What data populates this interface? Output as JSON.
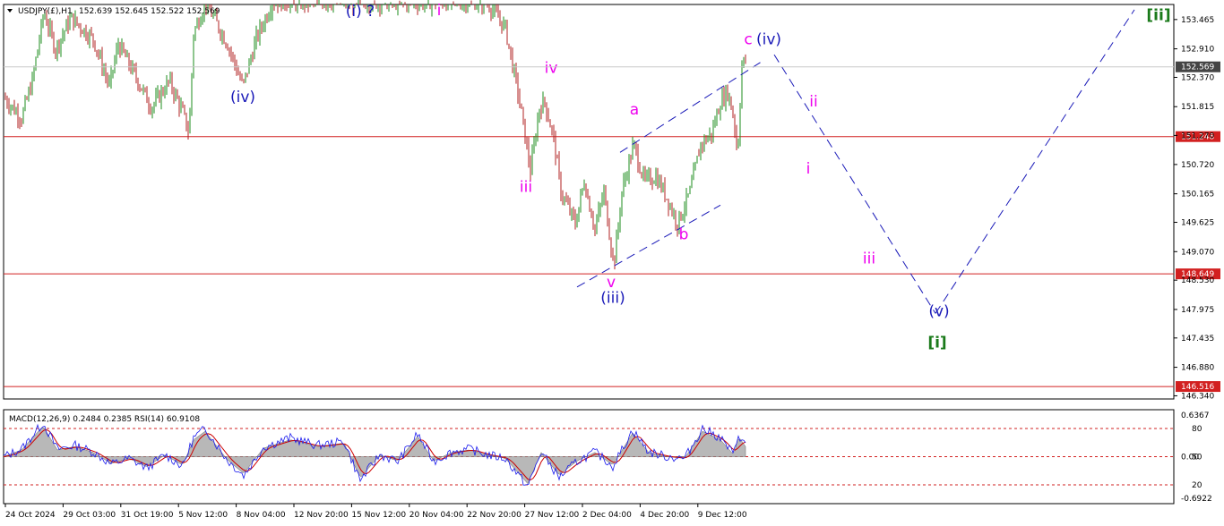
{
  "header": {
    "symbol": "USDJPY(£),H1",
    "ohlc": "152.639 152.645 152.522 152.569"
  },
  "indicator_header": "MACD(12,26,9) 0.2484 0.2385  RSI(14) 60.9108",
  "colors": {
    "bull": "#1e8c1e",
    "bear": "#b22222",
    "hline": "#d22020",
    "price_box": "#d22020",
    "current_box": "#444444",
    "pink": "#ee00ee",
    "blue": "#1a1ab8",
    "green": "#1a7a1a",
    "channel": "#1a1ab8",
    "macd_fill": "#b8b8b8",
    "macd_signal": "#cc0000",
    "rsi_line": "#1a1aee"
  },
  "chart_data": [
    {
      "type": "candlestick",
      "title": "",
      "price_axis": {
        "ticks": [
          "153.465",
          "152.910",
          "152.370",
          "151.815",
          "151.270",
          "150.720",
          "150.165",
          "149.625",
          "149.070",
          "148.530",
          "147.975",
          "147.435",
          "146.880",
          "146.340"
        ],
        "range": [
          146.28,
          153.75
        ]
      },
      "time_axis": {
        "ticks": [
          "24 Oct 2024",
          "29 Oct 03:00",
          "31 Oct 19:00",
          "5 Nov 12:00",
          "8 Nov 04:00",
          "12 Nov 20:00",
          "15 Nov 12:00",
          "20 Nov 04:00",
          "22 Nov 20:00",
          "27 Nov 12:00",
          "2 Dec 04:00",
          "4 Dec 20:00",
          "9 Dec 12:00"
        ]
      },
      "current_price": "152.569",
      "horizontal_levels": [
        {
          "value": 151.248,
          "label": "151.248"
        },
        {
          "value": 148.649,
          "label": "148.649"
        },
        {
          "value": 146.516,
          "label": "146.516"
        }
      ],
      "price_path": [
        {
          "t": 0,
          "p": 152.0
        },
        {
          "t": 20,
          "p": 151.6
        },
        {
          "t": 32,
          "p": 152.3
        },
        {
          "t": 45,
          "p": 153.6
        },
        {
          "t": 58,
          "p": 152.9
        },
        {
          "t": 75,
          "p": 153.5
        },
        {
          "t": 100,
          "p": 153.1
        },
        {
          "t": 118,
          "p": 152.2
        },
        {
          "t": 128,
          "p": 153.0
        },
        {
          "t": 150,
          "p": 152.3
        },
        {
          "t": 165,
          "p": 151.8
        },
        {
          "t": 185,
          "p": 152.3
        },
        {
          "t": 200,
          "p": 151.7
        },
        {
          "t": 207,
          "p": 151.3
        },
        {
          "t": 212,
          "p": 153.2
        },
        {
          "t": 225,
          "p": 153.8
        },
        {
          "t": 250,
          "p": 153.0
        },
        {
          "t": 267,
          "p": 152.2
        },
        {
          "t": 282,
          "p": 153.1
        },
        {
          "t": 300,
          "p": 153.8
        },
        {
          "t": 540,
          "p": 153.8
        },
        {
          "t": 560,
          "p": 153.3
        },
        {
          "t": 575,
          "p": 152.0
        },
        {
          "t": 588,
          "p": 150.6
        },
        {
          "t": 598,
          "p": 151.8
        },
        {
          "t": 604,
          "p": 151.9
        },
        {
          "t": 614,
          "p": 151.2
        },
        {
          "t": 622,
          "p": 150.2
        },
        {
          "t": 638,
          "p": 149.6
        },
        {
          "t": 648,
          "p": 150.4
        },
        {
          "t": 660,
          "p": 149.5
        },
        {
          "t": 670,
          "p": 150.2
        },
        {
          "t": 681,
          "p": 148.8
        },
        {
          "t": 690,
          "p": 150.2
        },
        {
          "t": 703,
          "p": 151.1
        },
        {
          "t": 715,
          "p": 150.4
        },
        {
          "t": 728,
          "p": 150.5
        },
        {
          "t": 740,
          "p": 150.1
        },
        {
          "t": 752,
          "p": 149.6
        },
        {
          "t": 766,
          "p": 150.2
        },
        {
          "t": 778,
          "p": 151.1
        },
        {
          "t": 790,
          "p": 151.3
        },
        {
          "t": 800,
          "p": 151.9
        },
        {
          "t": 808,
          "p": 152.1
        },
        {
          "t": 815,
          "p": 151.6
        },
        {
          "t": 819,
          "p": 150.9
        },
        {
          "t": 824,
          "p": 152.6
        },
        {
          "t": 828,
          "p": 152.7
        }
      ],
      "projection": [
        {
          "t": 860,
          "p": 152.8
        },
        {
          "t": 1040,
          "p": 147.9
        },
        {
          "t": 1262,
          "p": 153.65
        }
      ],
      "channel_lines": [
        {
          "from": {
            "t": 688,
            "p": 150.95
          },
          "to": {
            "t": 848,
            "p": 152.69
          }
        },
        {
          "from": {
            "t": 640,
            "p": 148.4
          },
          "to": {
            "t": 800,
            "p": 149.95
          }
        }
      ],
      "wave_labels": [
        {
          "text": "(i) ?",
          "t": 398,
          "p": 153.53,
          "color": "blue"
        },
        {
          "text": "i",
          "t": 486,
          "p": 153.55,
          "color": "pink"
        },
        {
          "text": "(iv)",
          "t": 267,
          "p": 151.9,
          "color": "blue"
        },
        {
          "text": "iv",
          "t": 611,
          "p": 152.45,
          "color": "pink"
        },
        {
          "text": "iii",
          "t": 583,
          "p": 150.2,
          "color": "pink"
        },
        {
          "text": "a",
          "t": 704,
          "p": 151.67,
          "color": "pink"
        },
        {
          "text": "b",
          "t": 759,
          "p": 149.3,
          "color": "pink"
        },
        {
          "text": "v",
          "t": 678,
          "p": 148.4,
          "color": "pink"
        },
        {
          "text": "(iii)",
          "t": 680,
          "p": 148.1,
          "color": "blue"
        },
        {
          "text": "c",
          "t": 831,
          "p": 153.0,
          "color": "pink"
        },
        {
          "text": "(iv)",
          "t": 854,
          "p": 153.0,
          "color": "blue"
        },
        {
          "text": "ii",
          "t": 904,
          "p": 151.82,
          "color": "pink"
        },
        {
          "text": "i",
          "t": 898,
          "p": 150.55,
          "color": "pink"
        },
        {
          "text": "iii",
          "t": 966,
          "p": 148.85,
          "color": "pink"
        },
        {
          "text": "(v)",
          "t": 1044,
          "p": 147.85,
          "color": "blue"
        },
        {
          "text": "[i]",
          "t": 1042,
          "p": 147.25,
          "color": "green"
        },
        {
          "text": "[ii]",
          "t": 1289,
          "p": 153.45,
          "color": "green"
        }
      ]
    },
    {
      "type": "line",
      "title": "MACD(12,26,9) 0.2484 0.2385  RSI(14) 60.9108",
      "left_axis_ticks": [
        "0.6367",
        "0.00",
        "-0.6922"
      ],
      "right_axis_ticks": [
        "80",
        "50",
        "20"
      ],
      "rsi_range": [
        0,
        100
      ],
      "rsi_levels": [
        80,
        50,
        20
      ],
      "rsi_path": [
        {
          "t": 0,
          "r": 50
        },
        {
          "t": 20,
          "r": 58
        },
        {
          "t": 44,
          "r": 86
        },
        {
          "t": 60,
          "r": 58
        },
        {
          "t": 80,
          "r": 62
        },
        {
          "t": 100,
          "r": 55
        },
        {
          "t": 120,
          "r": 42
        },
        {
          "t": 140,
          "r": 48
        },
        {
          "t": 160,
          "r": 38
        },
        {
          "t": 180,
          "r": 52
        },
        {
          "t": 200,
          "r": 40
        },
        {
          "t": 212,
          "r": 70
        },
        {
          "t": 225,
          "r": 80
        },
        {
          "t": 250,
          "r": 46
        },
        {
          "t": 268,
          "r": 30
        },
        {
          "t": 290,
          "r": 60
        },
        {
          "t": 320,
          "r": 70
        },
        {
          "t": 350,
          "r": 62
        },
        {
          "t": 380,
          "r": 66
        },
        {
          "t": 398,
          "r": 25
        },
        {
          "t": 420,
          "r": 52
        },
        {
          "t": 440,
          "r": 45
        },
        {
          "t": 462,
          "r": 74
        },
        {
          "t": 480,
          "r": 45
        },
        {
          "t": 500,
          "r": 55
        },
        {
          "t": 520,
          "r": 58
        },
        {
          "t": 540,
          "r": 52
        },
        {
          "t": 560,
          "r": 48
        },
        {
          "t": 585,
          "r": 18
        },
        {
          "t": 600,
          "r": 55
        },
        {
          "t": 620,
          "r": 28
        },
        {
          "t": 640,
          "r": 45
        },
        {
          "t": 660,
          "r": 55
        },
        {
          "t": 680,
          "r": 40
        },
        {
          "t": 702,
          "r": 78
        },
        {
          "t": 720,
          "r": 55
        },
        {
          "t": 740,
          "r": 50
        },
        {
          "t": 760,
          "r": 48
        },
        {
          "t": 780,
          "r": 80
        },
        {
          "t": 800,
          "r": 70
        },
        {
          "t": 815,
          "r": 52
        },
        {
          "t": 820,
          "r": 74
        },
        {
          "t": 828,
          "r": 62
        }
      ]
    }
  ]
}
